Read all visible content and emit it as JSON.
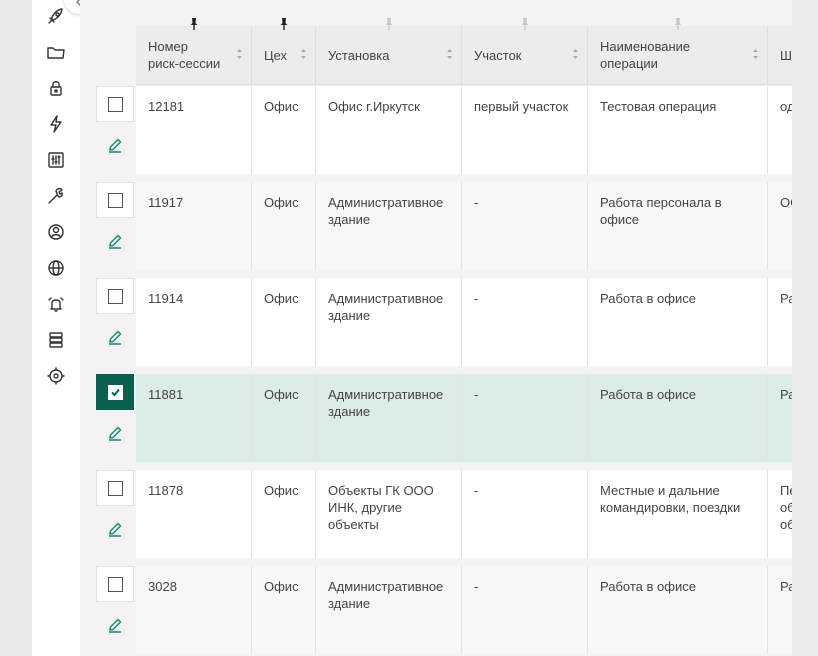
{
  "sidebar": {
    "icons": [
      "rocket-icon",
      "folder-icon",
      "lock-icon",
      "lightning-icon",
      "calculator-icon",
      "wrench-icon",
      "user-circle-icon",
      "globe-icon",
      "alarm-bell-icon",
      "database-icon",
      "target-icon"
    ]
  },
  "table": {
    "columns": [
      {
        "key": "num",
        "label": "Номер\nриск-сессии",
        "pinned": true,
        "sortable": true
      },
      {
        "key": "shop",
        "label": "Цех",
        "pinned": true,
        "sortable": true
      },
      {
        "key": "unit",
        "label": "Установка",
        "pinned": false,
        "sortable": true
      },
      {
        "key": "area",
        "label": "Участок",
        "pinned": false,
        "sortable": true
      },
      {
        "key": "op",
        "label": "Наименование\nоперации",
        "pinned": false,
        "sortable": true
      },
      {
        "key": "w",
        "label": "Ш",
        "pinned": false,
        "sortable": false
      }
    ],
    "rows": [
      {
        "num": "12181",
        "shop": "Офис",
        "unit": "Офис г.Иркутск",
        "area": "первый участок",
        "op": "Тестовая операция",
        "w": "од",
        "checked": false
      },
      {
        "num": "11917",
        "shop": "Офис",
        "unit": "Административное здание",
        "area": "-",
        "op": "Работа персонала в офисе",
        "w": "ОС",
        "checked": false
      },
      {
        "num": "11914",
        "shop": "Офис",
        "unit": "Административное здание",
        "area": "-",
        "op": "Работа в офисе",
        "w": "Ра",
        "checked": false
      },
      {
        "num": "11881",
        "shop": "Офис",
        "unit": "Административное здание",
        "area": "-",
        "op": "Работа в офисе",
        "w": "Ра",
        "checked": true
      },
      {
        "num": "11878",
        "shop": "Офис",
        "unit": "Объекты ГК ООО ИНК, другие объекты",
        "area": "-",
        "op": "Местные и дальние командировки, поездки",
        "w": "Пе\nоб\nоб",
        "checked": false
      },
      {
        "num": "3028",
        "shop": "Офис",
        "unit": "Административное здание",
        "area": "-",
        "op": "Работа в офисе",
        "w": "Ра",
        "checked": false
      }
    ]
  },
  "colors": {
    "accent": "#0c5e4f",
    "selected_row": "#dcece7",
    "edit_icon": "#1a8a74"
  }
}
